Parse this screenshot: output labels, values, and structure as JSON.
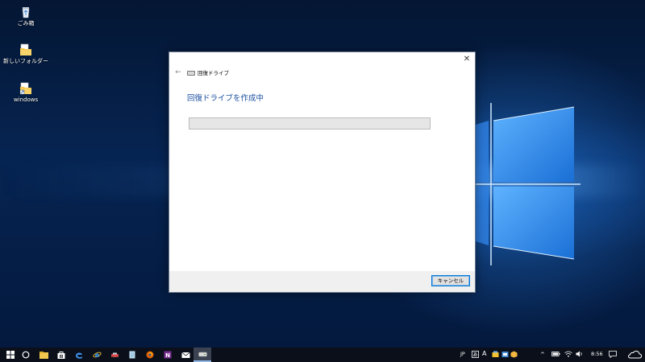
{
  "desktop": {
    "icons": [
      {
        "label": "ごみ箱",
        "icon": "recycle-bin-icon"
      },
      {
        "label": "新しいフォルダー",
        "icon": "folder-icon"
      },
      {
        "label": "windows",
        "icon": "folder-shortcut-icon"
      }
    ]
  },
  "dialog": {
    "title": "回復ドライブ",
    "heading": "回復ドライブを作成中",
    "progress": 0,
    "close_glyph": "✕",
    "back_glyph": "←",
    "cancel_label": "キャンセル"
  },
  "taskbar": {
    "pinned": [
      "start-icon",
      "cortana-icon",
      "file-explorer-icon",
      "store-icon",
      "edge-icon",
      "internet-explorer-icon",
      "app-icon",
      "notepad-icon",
      "firefox-icon",
      "onenote-icon",
      "mail-icon",
      "recovery-drive-icon"
    ],
    "tray": {
      "ime_language": "JP",
      "ime_mode": "A",
      "time": "8:56"
    }
  },
  "colors": {
    "accent": "#0078d7",
    "heading": "#1a4fa0",
    "taskbar": "#0a0f1a"
  }
}
